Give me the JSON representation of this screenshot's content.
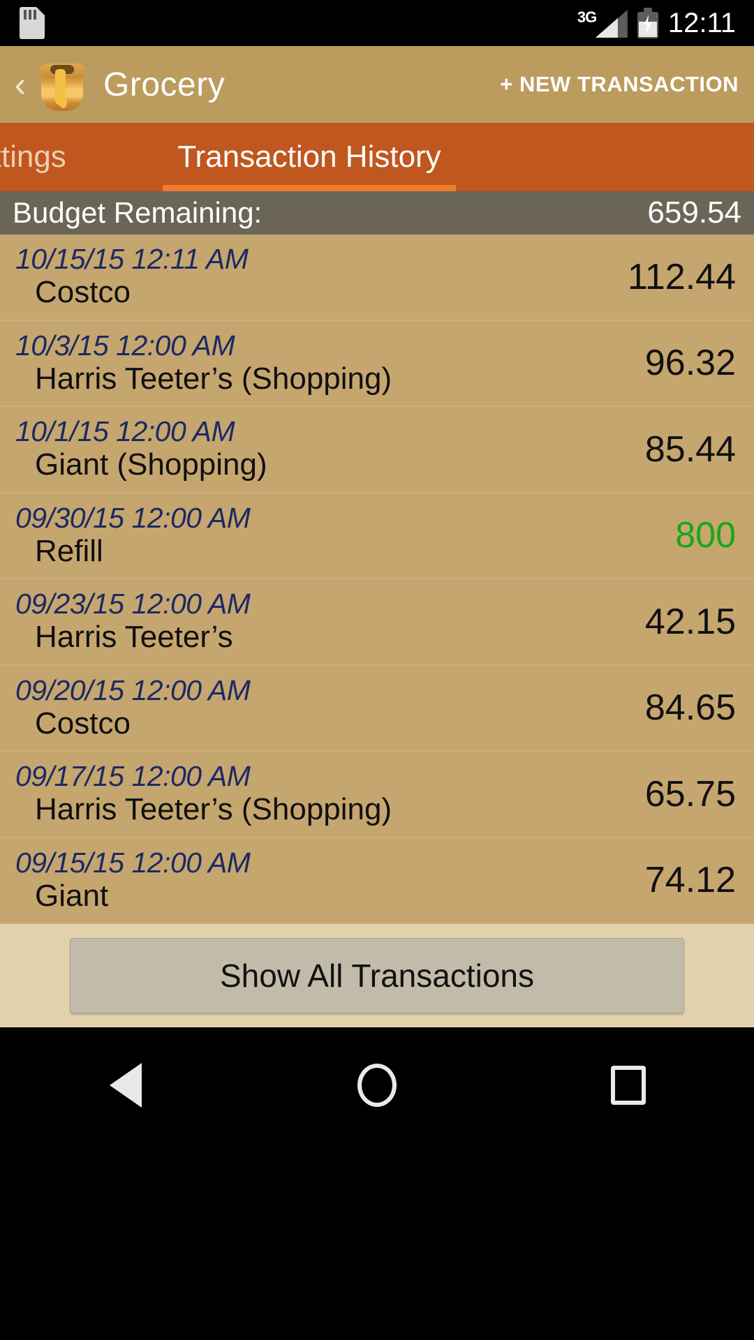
{
  "status_bar": {
    "sd_icon": "sd-card-icon",
    "network_type": "3G",
    "battery_icon": "battery-charging-icon",
    "time": "12:11"
  },
  "app_bar": {
    "back_label": "‹",
    "category_icon": "honey-pot-icon",
    "title": "Grocery",
    "new_transaction_label": "+ NEW TRANSACTION"
  },
  "tabs": [
    {
      "label": "ettings",
      "active": false
    },
    {
      "label": "Transaction History",
      "active": true
    }
  ],
  "budget": {
    "label": "Budget Remaining:",
    "value": "659.54"
  },
  "transactions": [
    {
      "date": "10/15/15 12:11 AM",
      "name": "Costco",
      "amount": "112.44",
      "type": "debit"
    },
    {
      "date": "10/3/15 12:00 AM",
      "name": "Harris Teeter’s (Shopping)",
      "amount": "96.32",
      "type": "debit"
    },
    {
      "date": "10/1/15 12:00 AM",
      "name": "Giant (Shopping)",
      "amount": "85.44",
      "type": "debit"
    },
    {
      "date": "09/30/15 12:00 AM",
      "name": "Refill",
      "amount": "800",
      "type": "credit"
    },
    {
      "date": "09/23/15 12:00 AM",
      "name": "Harris Teeter’s",
      "amount": "42.15",
      "type": "debit"
    },
    {
      "date": "09/20/15 12:00 AM",
      "name": "Costco",
      "amount": "84.65",
      "type": "debit"
    },
    {
      "date": "09/17/15 12:00 AM",
      "name": "Harris Teeter’s (Shopping)",
      "amount": "65.75",
      "type": "debit"
    },
    {
      "date": "09/15/15 12:00 AM",
      "name": "Giant",
      "amount": "74.12",
      "type": "debit"
    }
  ],
  "footer": {
    "show_all_label": "Show All Transactions"
  },
  "nav_bar": {
    "back_icon": "triangle-back-icon",
    "home_icon": "circle-home-icon",
    "recent_icon": "square-recents-icon"
  },
  "colors": {
    "app_bar": "#BC9B5E",
    "tab_bar": "#C0571F",
    "tab_indicator": "#EE7B2E",
    "budget_bar": "#6B6558",
    "list_bg": "#C6A66F",
    "footer_bg": "#E2D2AC",
    "button_bg": "#C3BBA9",
    "date_text": "#1C2A63",
    "credit_text": "#17A817"
  }
}
